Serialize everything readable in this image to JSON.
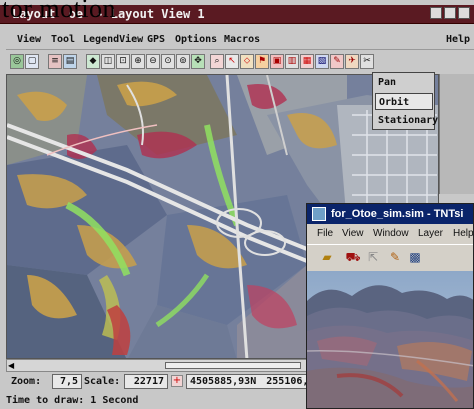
{
  "overlay_caption": "tor motion",
  "window": {
    "title_a": "Layout",
    "title_b": "- Layout View 1",
    "title_obscured_fragment": "oe"
  },
  "menu": [
    "View",
    "Tool",
    "LegendView",
    "GPS",
    "Options",
    "Macros"
  ],
  "menu_help": "Help",
  "toolbar_icons": [
    "zoom-extent-icon",
    "fit-icon",
    "legend-icon",
    "spacer",
    "layer-icon",
    "zoom-in-icon",
    "zoom-out-icon",
    "zoom-box-icon",
    "zoom-previous-icon",
    "zoom-next-icon",
    "pan-icon",
    "select-icon",
    "info-icon",
    "measure-icon",
    "gps-icon",
    "print-icon",
    "save-icon",
    "3d-icon",
    "table-icon",
    "sketch-icon",
    "simulation-icon"
  ],
  "dropdown": {
    "items": [
      "Pan",
      "Orbit",
      "Stationary"
    ],
    "selected": "Orbit"
  },
  "status": {
    "zoom_label": "Zoom:",
    "zoom_value": "7,5",
    "scale_label": "Scale:",
    "scale_value": "22717",
    "coordinates_a": "4505885,93N",
    "coordinates_b": "255106,10E",
    "time_to_draw": "Time to draw: 1 Second"
  },
  "sim_window": {
    "title": "for_Otoe_sim.sim - TNTsi",
    "menu": [
      "File",
      "View",
      "Window",
      "Layer",
      "Help"
    ],
    "toolbar_icons": [
      "folder-icon",
      "camera-icon",
      "arrows-icon",
      "pencil-icon",
      "map-icon"
    ]
  },
  "colors": {
    "title_bar": "#5a1a22",
    "sim_title": "#0a246a",
    "window_bg": "#c8c8c8"
  }
}
